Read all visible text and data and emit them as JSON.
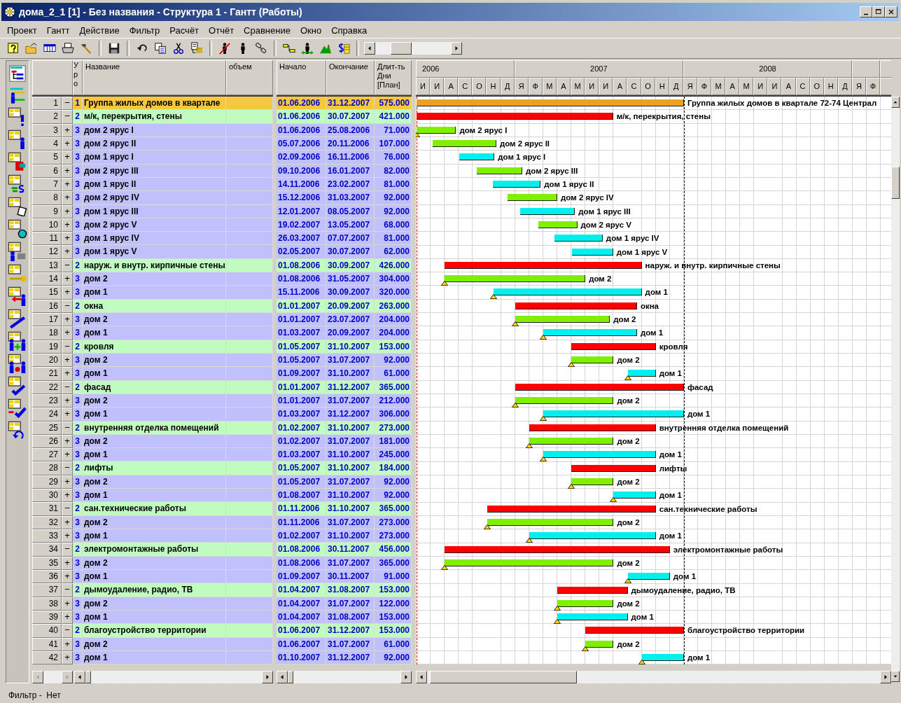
{
  "window": {
    "title": "дома_2_1 [1] - Без названия - Структура 1 - Гантт (Работы)"
  },
  "menu": [
    "Проект",
    "Гантт",
    "Действие",
    "Фильтр",
    "Расчёт",
    "Отчёт",
    "Сравнение",
    "Окно",
    "Справка"
  ],
  "columns": [
    "Уро",
    "Название",
    "объем",
    "Начало",
    "Окончание",
    "Длит-ть Дни [План]"
  ],
  "timeline": [
    {
      "year": "2006",
      "months": [
        "И",
        "И",
        "А",
        "С",
        "О",
        "Н",
        "Д"
      ]
    },
    {
      "year": "2007",
      "months": [
        "Я",
        "Ф",
        "М",
        "А",
        "М",
        "И",
        "И",
        "А",
        "С",
        "О",
        "Н",
        "Д"
      ]
    },
    {
      "year": "2008",
      "months": [
        "Я",
        "Ф",
        "М",
        "А",
        "М",
        "И",
        "И",
        "А",
        "С",
        "О",
        "Н",
        "Д"
      ]
    },
    {
      "months": [
        "Я",
        "Ф"
      ]
    }
  ],
  "rows": [
    {
      "num": "1",
      "toggle": "−",
      "level": "1",
      "kind": "group",
      "name": "Группа жилых домов в квартале",
      "start": "01.06.2006",
      "end": "31.12.2007",
      "duration": "575.000",
      "color": "#f0a020",
      "bar_label": "Группа жилых домов в квартале 72-74 Централ",
      "milestone": false
    },
    {
      "num": "2",
      "toggle": "−",
      "level": "2",
      "kind": "subgroup",
      "name": "м/к, перекрытия, стены",
      "start": "01.06.2006",
      "end": "30.07.2007",
      "duration": "421.000",
      "color": "#ff0000",
      "bar_label": "м/к, перекрытия, стены",
      "milestone": false
    },
    {
      "num": "3",
      "toggle": "+",
      "level": "3",
      "kind": "task",
      "name": "дом 2 ярус I",
      "start": "01.06.2006",
      "end": "25.08.2006",
      "duration": "71.000",
      "color": "#80f000",
      "bar_label": "дом 2 ярус I",
      "milestone": true
    },
    {
      "num": "4",
      "toggle": "+",
      "level": "3",
      "kind": "task",
      "name": "дом 2 ярус II",
      "start": "05.07.2006",
      "end": "20.11.2006",
      "duration": "107.000",
      "color": "#80f000",
      "bar_label": "дом 2 ярус II",
      "milestone": false
    },
    {
      "num": "5",
      "toggle": "+",
      "level": "3",
      "kind": "task",
      "name": "дом 1 ярус I",
      "start": "02.09.2006",
      "end": "16.11.2006",
      "duration": "76.000",
      "color": "#00f0f0",
      "bar_label": "дом 1 ярус I",
      "milestone": false
    },
    {
      "num": "6",
      "toggle": "+",
      "level": "3",
      "kind": "task",
      "name": "дом 2 ярус III",
      "start": "09.10.2006",
      "end": "16.01.2007",
      "duration": "82.000",
      "color": "#80f000",
      "bar_label": "дом 2 ярус III",
      "milestone": false
    },
    {
      "num": "7",
      "toggle": "+",
      "level": "3",
      "kind": "task",
      "name": "дом 1 ярус II",
      "start": "14.11.2006",
      "end": "23.02.2007",
      "duration": "81.000",
      "color": "#00f0f0",
      "bar_label": "дом 1 ярус II",
      "milestone": false
    },
    {
      "num": "8",
      "toggle": "+",
      "level": "3",
      "kind": "task",
      "name": "дом 2 ярус IV",
      "start": "15.12.2006",
      "end": "31.03.2007",
      "duration": "92.000",
      "color": "#80f000",
      "bar_label": "дом 2 ярус IV",
      "milestone": false
    },
    {
      "num": "9",
      "toggle": "+",
      "level": "3",
      "kind": "task",
      "name": "дом 1 ярус III",
      "start": "12.01.2007",
      "end": "08.05.2007",
      "duration": "92.000",
      "color": "#00f0f0",
      "bar_label": "дом 1 ярус III",
      "milestone": false
    },
    {
      "num": "10",
      "toggle": "+",
      "level": "3",
      "kind": "task",
      "name": "дом 2 ярус V",
      "start": "19.02.2007",
      "end": "13.05.2007",
      "duration": "68.000",
      "color": "#80f000",
      "bar_label": "дом 2 ярус V",
      "milestone": false
    },
    {
      "num": "11",
      "toggle": "+",
      "level": "3",
      "kind": "task",
      "name": "дом 1 ярус IV",
      "start": "26.03.2007",
      "end": "07.07.2007",
      "duration": "81.000",
      "color": "#00f0f0",
      "bar_label": "дом 1 ярус IV",
      "milestone": false
    },
    {
      "num": "12",
      "toggle": "+",
      "level": "3",
      "kind": "task",
      "name": "дом 1 ярус V",
      "start": "02.05.2007",
      "end": "30.07.2007",
      "duration": "62.000",
      "color": "#00f0f0",
      "bar_label": "дом 1 ярус V",
      "milestone": false
    },
    {
      "num": "13",
      "toggle": "−",
      "level": "2",
      "kind": "subgroup",
      "name": "наруж. и внутр. кирпичные стены",
      "start": "01.08.2006",
      "end": "30.09.2007",
      "duration": "426.000",
      "color": "#ff0000",
      "bar_label": "наруж. и внутр. кирпичные стены",
      "milestone": false
    },
    {
      "num": "14",
      "toggle": "+",
      "level": "3",
      "kind": "task",
      "name": "дом 2",
      "start": "01.08.2006",
      "end": "31.05.2007",
      "duration": "304.000",
      "color": "#80f000",
      "bar_label": "дом 2",
      "milestone": true
    },
    {
      "num": "15",
      "toggle": "+",
      "level": "3",
      "kind": "task",
      "name": "дом 1",
      "start": "15.11.2006",
      "end": "30.09.2007",
      "duration": "320.000",
      "color": "#00f0f0",
      "bar_label": "дом 1",
      "milestone": true
    },
    {
      "num": "16",
      "toggle": "−",
      "level": "2",
      "kind": "subgroup",
      "name": "окна",
      "start": "01.01.2007",
      "end": "20.09.2007",
      "duration": "263.000",
      "color": "#ff0000",
      "bar_label": "окна",
      "milestone": false
    },
    {
      "num": "17",
      "toggle": "+",
      "level": "3",
      "kind": "task",
      "name": "дом 2",
      "start": "01.01.2007",
      "end": "23.07.2007",
      "duration": "204.000",
      "color": "#80f000",
      "bar_label": "дом 2",
      "milestone": true
    },
    {
      "num": "18",
      "toggle": "+",
      "level": "3",
      "kind": "task",
      "name": "дом 1",
      "start": "01.03.2007",
      "end": "20.09.2007",
      "duration": "204.000",
      "color": "#00f0f0",
      "bar_label": "дом 1",
      "milestone": true
    },
    {
      "num": "19",
      "toggle": "−",
      "level": "2",
      "kind": "subgroup",
      "name": "кровля",
      "start": "01.05.2007",
      "end": "31.10.2007",
      "duration": "153.000",
      "color": "#ff0000",
      "bar_label": "кровля",
      "milestone": false
    },
    {
      "num": "20",
      "toggle": "+",
      "level": "3",
      "kind": "task",
      "name": "дом 2",
      "start": "01.05.2007",
      "end": "31.07.2007",
      "duration": "92.000",
      "color": "#80f000",
      "bar_label": "дом 2",
      "milestone": true
    },
    {
      "num": "21",
      "toggle": "+",
      "level": "3",
      "kind": "task",
      "name": "дом 1",
      "start": "01.09.2007",
      "end": "31.10.2007",
      "duration": "61.000",
      "color": "#00f0f0",
      "bar_label": "дом 1",
      "milestone": true
    },
    {
      "num": "22",
      "toggle": "−",
      "level": "2",
      "kind": "subgroup",
      "name": "фасад",
      "start": "01.01.2007",
      "end": "31.12.2007",
      "duration": "365.000",
      "color": "#ff0000",
      "bar_label": "фасад",
      "milestone": false
    },
    {
      "num": "23",
      "toggle": "+",
      "level": "3",
      "kind": "task",
      "name": "дом 2",
      "start": "01.01.2007",
      "end": "31.07.2007",
      "duration": "212.000",
      "color": "#80f000",
      "bar_label": "дом 2",
      "milestone": true
    },
    {
      "num": "24",
      "toggle": "+",
      "level": "3",
      "kind": "task",
      "name": "дом 1",
      "start": "01.03.2007",
      "end": "31.12.2007",
      "duration": "306.000",
      "color": "#00f0f0",
      "bar_label": "дом 1",
      "milestone": true
    },
    {
      "num": "25",
      "toggle": "−",
      "level": "2",
      "kind": "subgroup",
      "name": "внутренняя отделка помещений",
      "start": "01.02.2007",
      "end": "31.10.2007",
      "duration": "273.000",
      "color": "#ff0000",
      "bar_label": "внутренняя отделка помещений",
      "milestone": false
    },
    {
      "num": "26",
      "toggle": "+",
      "level": "3",
      "kind": "task",
      "name": "дом 2",
      "start": "01.02.2007",
      "end": "31.07.2007",
      "duration": "181.000",
      "color": "#80f000",
      "bar_label": "дом 2",
      "milestone": true
    },
    {
      "num": "27",
      "toggle": "+",
      "level": "3",
      "kind": "task",
      "name": "дом 1",
      "start": "01.03.2007",
      "end": "31.10.2007",
      "duration": "245.000",
      "color": "#00f0f0",
      "bar_label": "дом 1",
      "milestone": true
    },
    {
      "num": "28",
      "toggle": "−",
      "level": "2",
      "kind": "subgroup",
      "name": "лифты",
      "start": "01.05.2007",
      "end": "31.10.2007",
      "duration": "184.000",
      "color": "#ff0000",
      "bar_label": "лифты",
      "milestone": false
    },
    {
      "num": "29",
      "toggle": "+",
      "level": "3",
      "kind": "task",
      "name": "дом 2",
      "start": "01.05.2007",
      "end": "31.07.2007",
      "duration": "92.000",
      "color": "#80f000",
      "bar_label": "дом 2",
      "milestone": true
    },
    {
      "num": "30",
      "toggle": "+",
      "level": "3",
      "kind": "task",
      "name": "дом 1",
      "start": "01.08.2007",
      "end": "31.10.2007",
      "duration": "92.000",
      "color": "#00f0f0",
      "bar_label": "дом 1",
      "milestone": true
    },
    {
      "num": "31",
      "toggle": "−",
      "level": "2",
      "kind": "subgroup",
      "name": "сан.технические работы",
      "start": "01.11.2006",
      "end": "31.10.2007",
      "duration": "365.000",
      "color": "#ff0000",
      "bar_label": "сан.технические работы",
      "milestone": false
    },
    {
      "num": "32",
      "toggle": "+",
      "level": "3",
      "kind": "task",
      "name": "дом 2",
      "start": "01.11.2006",
      "end": "31.07.2007",
      "duration": "273.000",
      "color": "#80f000",
      "bar_label": "дом 2",
      "milestone": true
    },
    {
      "num": "33",
      "toggle": "+",
      "level": "3",
      "kind": "task",
      "name": "дом 1",
      "start": "01.02.2007",
      "end": "31.10.2007",
      "duration": "273.000",
      "color": "#00f0f0",
      "bar_label": "дом 1",
      "milestone": true
    },
    {
      "num": "34",
      "toggle": "−",
      "level": "2",
      "kind": "subgroup",
      "name": "электромонтажные работы",
      "start": "01.08.2006",
      "end": "30.11.2007",
      "duration": "456.000",
      "color": "#ff0000",
      "bar_label": "электромонтажные работы",
      "milestone": false
    },
    {
      "num": "35",
      "toggle": "+",
      "level": "3",
      "kind": "task",
      "name": "дом 2",
      "start": "01.08.2006",
      "end": "31.07.2007",
      "duration": "365.000",
      "color": "#80f000",
      "bar_label": "дом 2",
      "milestone": true
    },
    {
      "num": "36",
      "toggle": "+",
      "level": "3",
      "kind": "task",
      "name": "дом 1",
      "start": "01.09.2007",
      "end": "30.11.2007",
      "duration": "91.000",
      "color": "#00f0f0",
      "bar_label": "дом 1",
      "milestone": true
    },
    {
      "num": "37",
      "toggle": "−",
      "level": "2",
      "kind": "subgroup",
      "name": "дымоудаление, радио, ТВ",
      "start": "01.04.2007",
      "end": "31.08.2007",
      "duration": "153.000",
      "color": "#ff0000",
      "bar_label": "дымоудаление, радио, ТВ",
      "milestone": false
    },
    {
      "num": "38",
      "toggle": "+",
      "level": "3",
      "kind": "task",
      "name": "дом 2",
      "start": "01.04.2007",
      "end": "31.07.2007",
      "duration": "122.000",
      "color": "#80f000",
      "bar_label": "дом 2",
      "milestone": true
    },
    {
      "num": "39",
      "toggle": "+",
      "level": "3",
      "kind": "task",
      "name": "дом 1",
      "start": "01.04.2007",
      "end": "31.08.2007",
      "duration": "153.000",
      "color": "#00f0f0",
      "bar_label": "дом 1",
      "milestone": true
    },
    {
      "num": "40",
      "toggle": "−",
      "level": "2",
      "kind": "subgroup",
      "name": "благоустройство территории",
      "start": "01.06.2007",
      "end": "31.12.2007",
      "duration": "153.000",
      "color": "#ff0000",
      "bar_label": "благоустройство территории",
      "milestone": false
    },
    {
      "num": "41",
      "toggle": "+",
      "level": "3",
      "kind": "task",
      "name": "дом 2",
      "start": "01.06.2007",
      "end": "31.07.2007",
      "duration": "61.000",
      "color": "#80f000",
      "bar_label": "дом 2",
      "milestone": true
    },
    {
      "num": "42",
      "toggle": "+",
      "level": "3",
      "kind": "task",
      "name": "дом 1",
      "start": "01.10.2007",
      "end": "31.12.2007",
      "duration": "92.000",
      "color": "#00f0f0",
      "bar_label": "дом 1",
      "milestone": true
    }
  ],
  "status_bar": "Фильтр -  Нет"
}
